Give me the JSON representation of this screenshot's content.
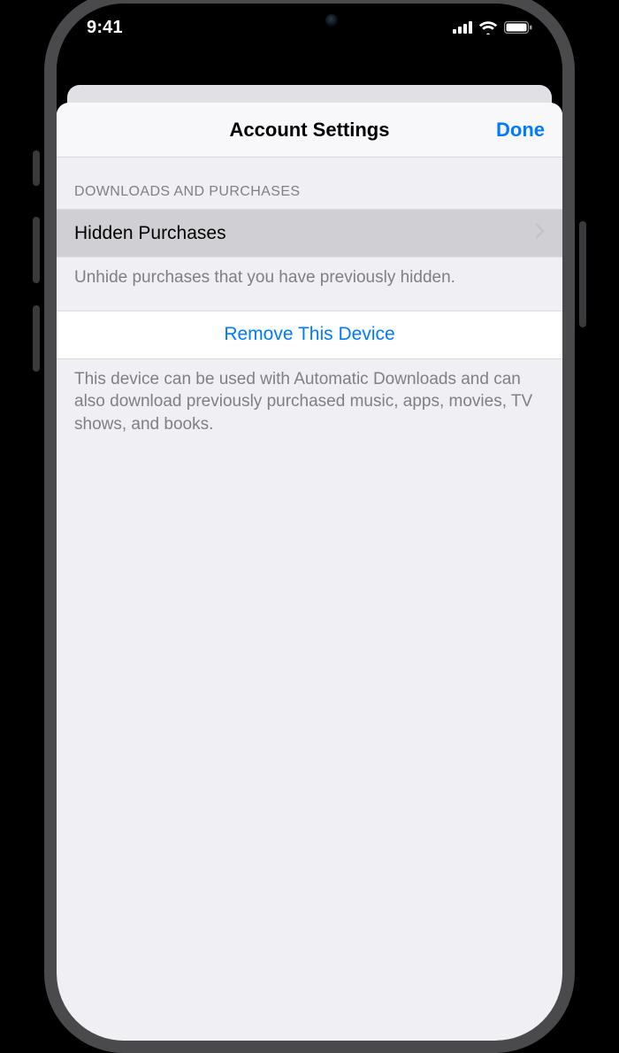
{
  "status": {
    "time": "9:41"
  },
  "nav": {
    "title": "Account Settings",
    "done": "Done"
  },
  "section": {
    "header": "DOWNLOADS AND PURCHASES",
    "hidden_purchases": "Hidden Purchases",
    "hidden_footer": "Unhide purchases that you have previously hidden.",
    "remove_device": "Remove This Device",
    "device_footer": "This device can be used with Automatic Downloads and can also download previously purchased music, apps, movies, TV shows, and books."
  }
}
